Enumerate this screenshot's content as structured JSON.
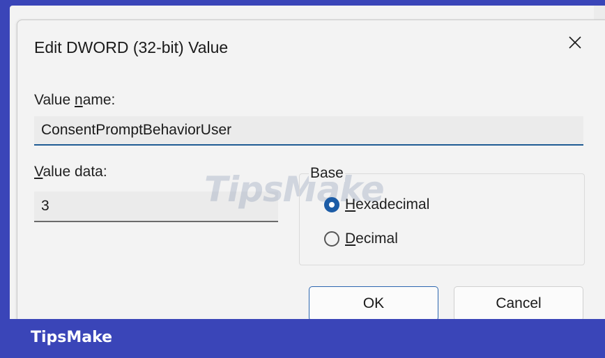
{
  "dialog": {
    "title": "Edit DWORD (32-bit) Value",
    "close_icon": "close-icon",
    "value_name_label_pre": "Value ",
    "value_name_label_access": "n",
    "value_name_label_post": "ame:",
    "value_name": "ConsentPromptBehaviorUser",
    "value_data_label_access": "V",
    "value_data_label_post": "alue data:",
    "value_data": "3",
    "base_label": "Base",
    "radio_hex_access": "H",
    "radio_hex_rest": "exadecimal",
    "radio_dec_access": "D",
    "radio_dec_rest": "ecimal",
    "selected_base": "Hexadecimal",
    "ok_label": "OK",
    "cancel_label": "Cancel"
  },
  "watermark": "TipsMake",
  "footer": {
    "brand": "TipsMake"
  },
  "colors": {
    "background_bar": "#3a45b8",
    "dialog_bg": "#f3f3f3",
    "accent": "#1c5ca6"
  }
}
